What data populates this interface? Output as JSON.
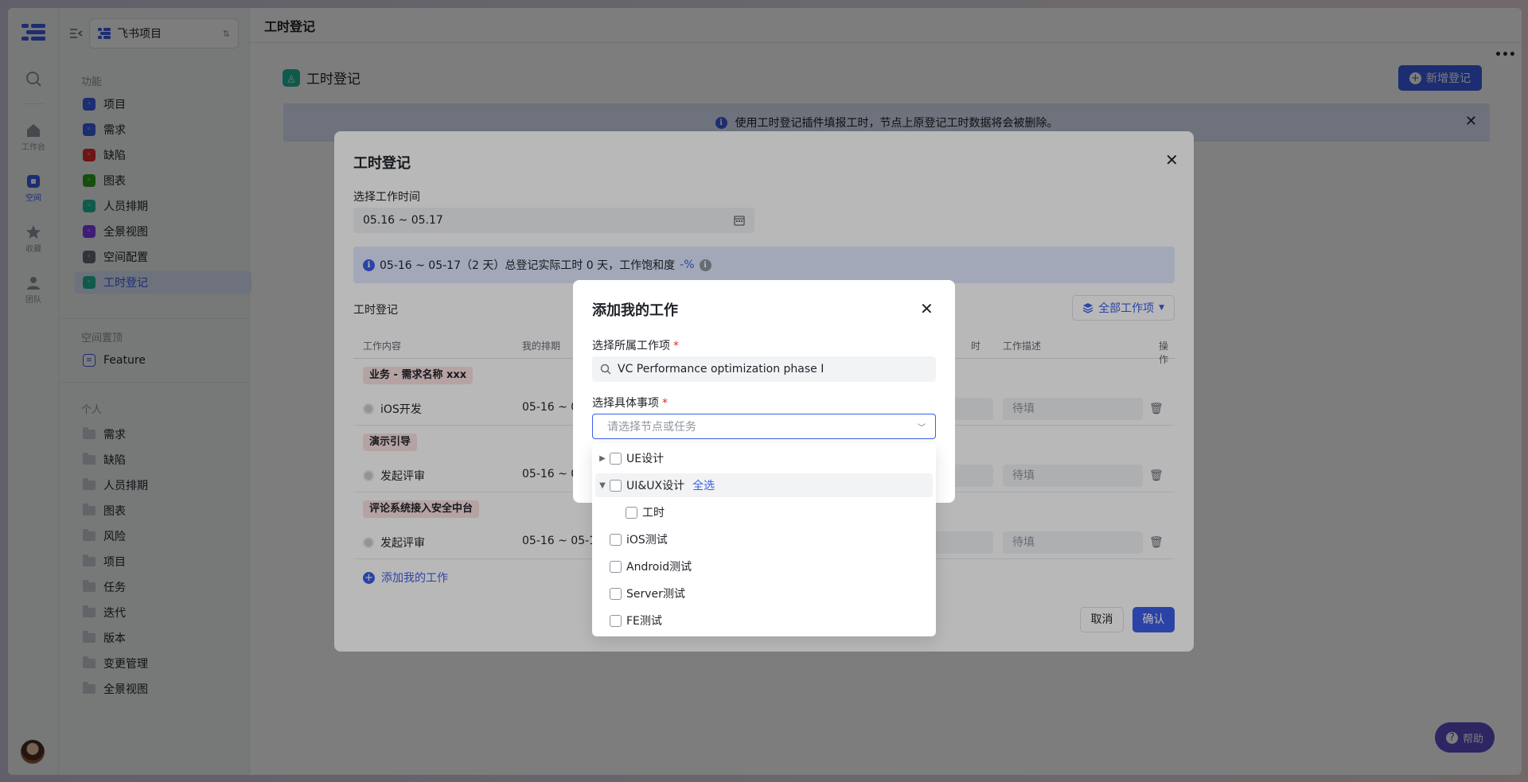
{
  "window": {
    "title": "工时登记",
    "more": "•••"
  },
  "rail": {
    "items": [
      {
        "label": "工作台"
      },
      {
        "label": "空间"
      },
      {
        "label": "收藏"
      },
      {
        "label": "团队"
      }
    ]
  },
  "sidebar": {
    "project": "飞书项目",
    "features_title": "功能",
    "features": [
      {
        "label": "项目",
        "color": "#3c5ee8"
      },
      {
        "label": "需求",
        "color": "#3c5ee8"
      },
      {
        "label": "缺陷",
        "color": "#e22e28"
      },
      {
        "label": "图表",
        "color": "#2ea121"
      },
      {
        "label": "人员排期",
        "color": "#1fb89a"
      },
      {
        "label": "全景视图",
        "color": "#7f3bf5"
      },
      {
        "label": "空间配置",
        "color": "#646a73"
      },
      {
        "label": "工时登记",
        "color": "#1fb89a"
      }
    ],
    "pinned_title": "空间置顶",
    "pinned": [
      {
        "label": "Feature"
      }
    ],
    "personal_title": "个人",
    "personal": [
      "需求",
      "缺陷",
      "人员排期",
      "图表",
      "风险",
      "项目",
      "任务",
      "迭代",
      "版本",
      "变更管理",
      "全景视图"
    ]
  },
  "page": {
    "heading": "工时登记",
    "new_button": "新增登记",
    "banner": "使用工时登记插件填报工时，节点上原登记工时数据将会被删除。",
    "help": "帮助"
  },
  "modal": {
    "title": "工时登记",
    "time_label": "选择工作时间",
    "date_range": "05.16 ~ 05.17",
    "summary_prefix": "05-16 ~ 05-17（2 天）总登记实际工时 0 天，工作饱和度",
    "summary_pct": "-%",
    "section_label": "工时登记",
    "all_items_button": "全部工作项",
    "columns": {
      "content": "工作内容",
      "schedule": "我的排期",
      "actual": "时",
      "desc": "工作描述",
      "ops": "操作"
    },
    "groups": [
      {
        "tag": "业务 - 需求名称 xxx",
        "task": "iOS开发",
        "dates": "05-16 ~ 0",
        "desc": "待填"
      },
      {
        "tag": "演示引导",
        "task": "发起评审",
        "dates": "05-16 ~ 0",
        "desc": "待填"
      },
      {
        "tag": "评论系统接入安全中台",
        "task": "发起评审",
        "dates": "05-16 ~ 05-17",
        "desc": "待填"
      }
    ],
    "add_work": "添加我的工作",
    "cancel": "取消",
    "confirm": "确认"
  },
  "add_dialog": {
    "title": "添加我的工作",
    "work_item_label": "选择所属工作项",
    "work_item_value": "VC Performance optimization phase I",
    "detail_label": "选择具体事项",
    "detail_placeholder": "请选择节点或任务",
    "required_mark": "*",
    "options": [
      {
        "label": "UE设计",
        "arrow": "▶",
        "indent": 0
      },
      {
        "label": "UI&UX设计",
        "arrow": "▼",
        "indent": 0,
        "select_all": "全选"
      },
      {
        "label": "工时",
        "arrow": "",
        "indent": 1
      },
      {
        "label": "iOS测试",
        "arrow": "",
        "indent": 0
      },
      {
        "label": "Android测试",
        "arrow": "",
        "indent": 0
      },
      {
        "label": "Server测试",
        "arrow": "",
        "indent": 0
      },
      {
        "label": "FE测试",
        "arrow": "",
        "indent": 0
      }
    ]
  }
}
